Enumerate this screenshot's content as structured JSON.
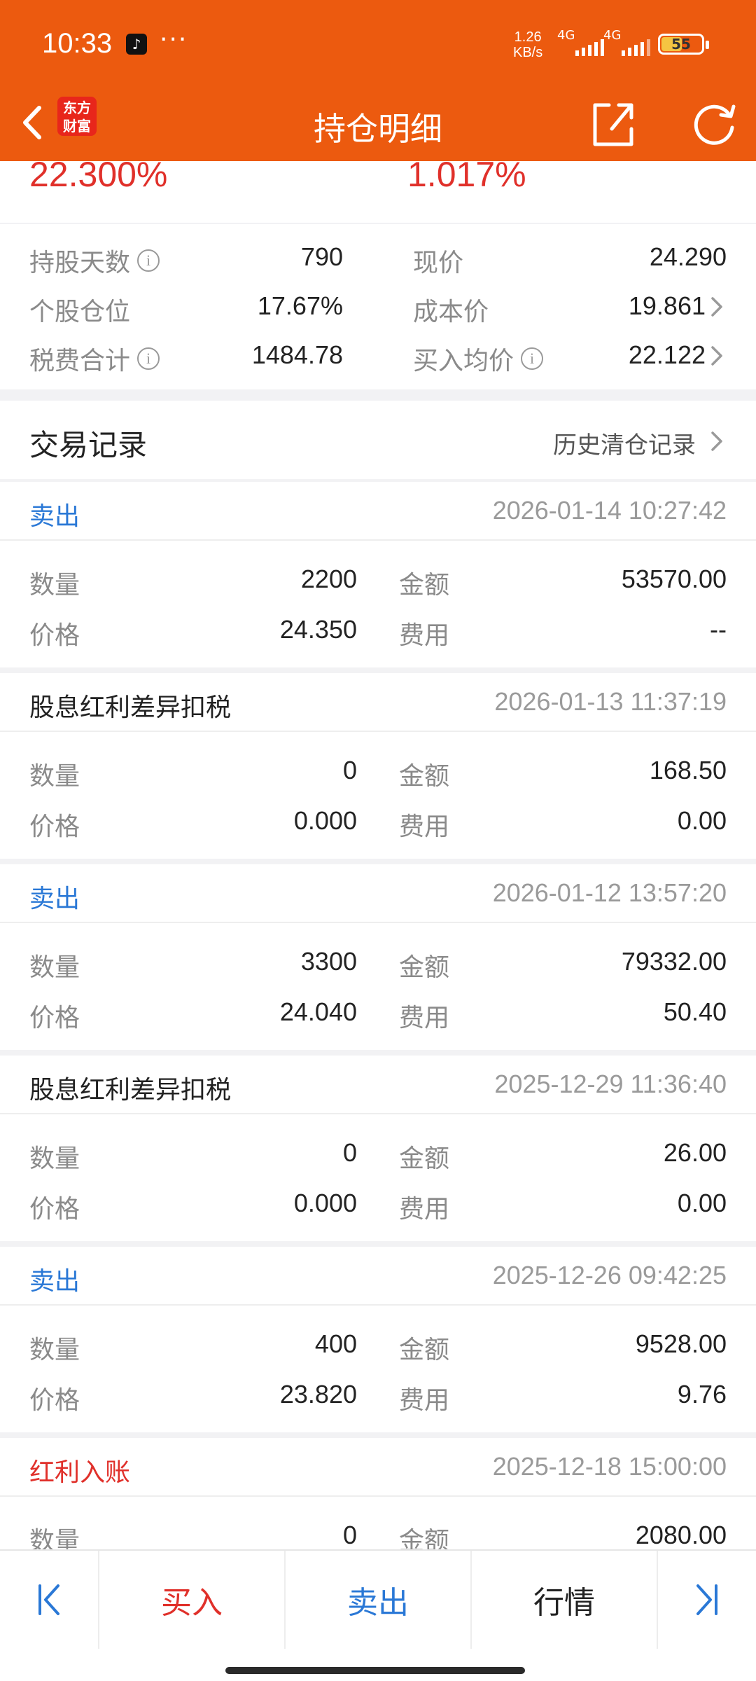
{
  "status_bar": {
    "time": "10:33",
    "app_icon": "tiktok-icon",
    "more": "···",
    "speed_value": "1.26",
    "speed_unit": "KB/s",
    "signal1_label": "4G",
    "signal2_label": "4G",
    "battery": "55",
    "battery_fraction": 0.55
  },
  "header": {
    "title": "持仓明细",
    "logo_line1": "东方",
    "logo_line2": "财富",
    "back_icon": "chevron-left-icon",
    "share_icon": "share-icon",
    "refresh_icon": "refresh-icon",
    "color": "#ec5a0f"
  },
  "summary": {
    "pct_left": "22.300%",
    "pct_right": "1.017%",
    "stats": [
      {
        "label": "持股天数",
        "value": "790",
        "info": true
      },
      {
        "label": "现价",
        "value": "24.290"
      },
      {
        "label": "个股仓位",
        "value": "17.67%"
      },
      {
        "label": "成本价",
        "value": "19.861",
        "arrow": true
      },
      {
        "label": "税费合计",
        "value": "1484.78",
        "info": true
      },
      {
        "label": "买入均价",
        "value": "22.122",
        "info": true,
        "arrow": true
      }
    ]
  },
  "trades": {
    "title": "交易记录",
    "history_link": "历史清仓记录",
    "field_labels": {
      "qty": "数量",
      "amount": "金额",
      "price": "价格",
      "fee": "费用"
    },
    "records": [
      {
        "type": "卖出",
        "kind": "sell",
        "time": "2026-01-14 10:27:42",
        "qty": "2200",
        "amount": "53570.00",
        "price": "24.350",
        "fee": "--"
      },
      {
        "type": "股息红利差异扣税",
        "kind": "tax",
        "time": "2026-01-13 11:37:19",
        "qty": "0",
        "amount": "168.50",
        "price": "0.000",
        "fee": "0.00"
      },
      {
        "type": "卖出",
        "kind": "sell",
        "time": "2026-01-12 13:57:20",
        "qty": "3300",
        "amount": "79332.00",
        "price": "24.040",
        "fee": "50.40"
      },
      {
        "type": "股息红利差异扣税",
        "kind": "tax",
        "time": "2025-12-29 11:36:40",
        "qty": "0",
        "amount": "26.00",
        "price": "0.000",
        "fee": "0.00"
      },
      {
        "type": "卖出",
        "kind": "sell",
        "time": "2025-12-26 09:42:25",
        "qty": "400",
        "amount": "9528.00",
        "price": "23.820",
        "fee": "9.76"
      },
      {
        "type": "红利入账",
        "kind": "div",
        "time": "2025-12-18 15:00:00",
        "qty": "0",
        "amount": "2080.00"
      }
    ]
  },
  "bottom_bar": {
    "first_icon": "skip-first-icon",
    "buy": "买入",
    "sell": "卖出",
    "quote": "行情",
    "last_icon": "skip-last-icon",
    "buy_color": "#e0302a",
    "sell_color": "#2a78d6"
  }
}
